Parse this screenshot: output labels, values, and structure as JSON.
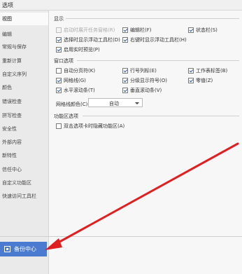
{
  "window": {
    "title": "选项"
  },
  "sidebar": {
    "items": [
      {
        "label": "视图"
      },
      {
        "label": "编辑"
      },
      {
        "label": "常规与保存"
      },
      {
        "label": "重新计算"
      },
      {
        "label": "自定义序列"
      },
      {
        "label": "颜色"
      },
      {
        "label": "错误检查"
      },
      {
        "label": "拼写检查"
      },
      {
        "label": "安全性"
      },
      {
        "label": "外部内容"
      },
      {
        "label": "新特性"
      },
      {
        "label": "信任中心"
      },
      {
        "label": "自定义功能区"
      },
      {
        "label": "快速访问工具栏"
      }
    ],
    "active_index": 0,
    "backup_label": "备份中心"
  },
  "sections": {
    "display": {
      "title": "显示",
      "options": [
        {
          "label": "启动时展开任务窗格(R)",
          "checked": false,
          "disabled": true
        },
        {
          "label": "编辑栏(F)",
          "checked": true,
          "disabled": false
        },
        {
          "label": "状态栏(S)",
          "checked": true,
          "disabled": false
        },
        {
          "label": "选择时显示浮动工具栏(D)",
          "checked": true,
          "disabled": false
        },
        {
          "label": "右键时显示浮动工具栏(H)",
          "checked": true,
          "disabled": false
        },
        {
          "label": "启用实时预览(P)",
          "checked": true,
          "disabled": false
        }
      ]
    },
    "window": {
      "title": "窗口选项",
      "options": [
        {
          "label": "自动分页符(K)",
          "checked": false
        },
        {
          "label": "行号列标(E)",
          "checked": true
        },
        {
          "label": "工作表标签(B)",
          "checked": true
        },
        {
          "label": "网格线(G)",
          "checked": true
        },
        {
          "label": "分级显示符号(O)",
          "checked": true
        },
        {
          "label": "零值(Z)",
          "checked": true
        },
        {
          "label": "水平滚动条(T)",
          "checked": true
        },
        {
          "label": "垂直滚动条(V)",
          "checked": true
        }
      ],
      "gridline_color_label": "网格线颜色(C):",
      "gridline_color_value": "自动"
    },
    "ribbon": {
      "title": "功能区选项",
      "options": [
        {
          "label": "双击选项卡时隐藏功能区(A)",
          "checked": false
        }
      ]
    }
  },
  "annotation": {
    "arrow_color": "#e02020"
  }
}
